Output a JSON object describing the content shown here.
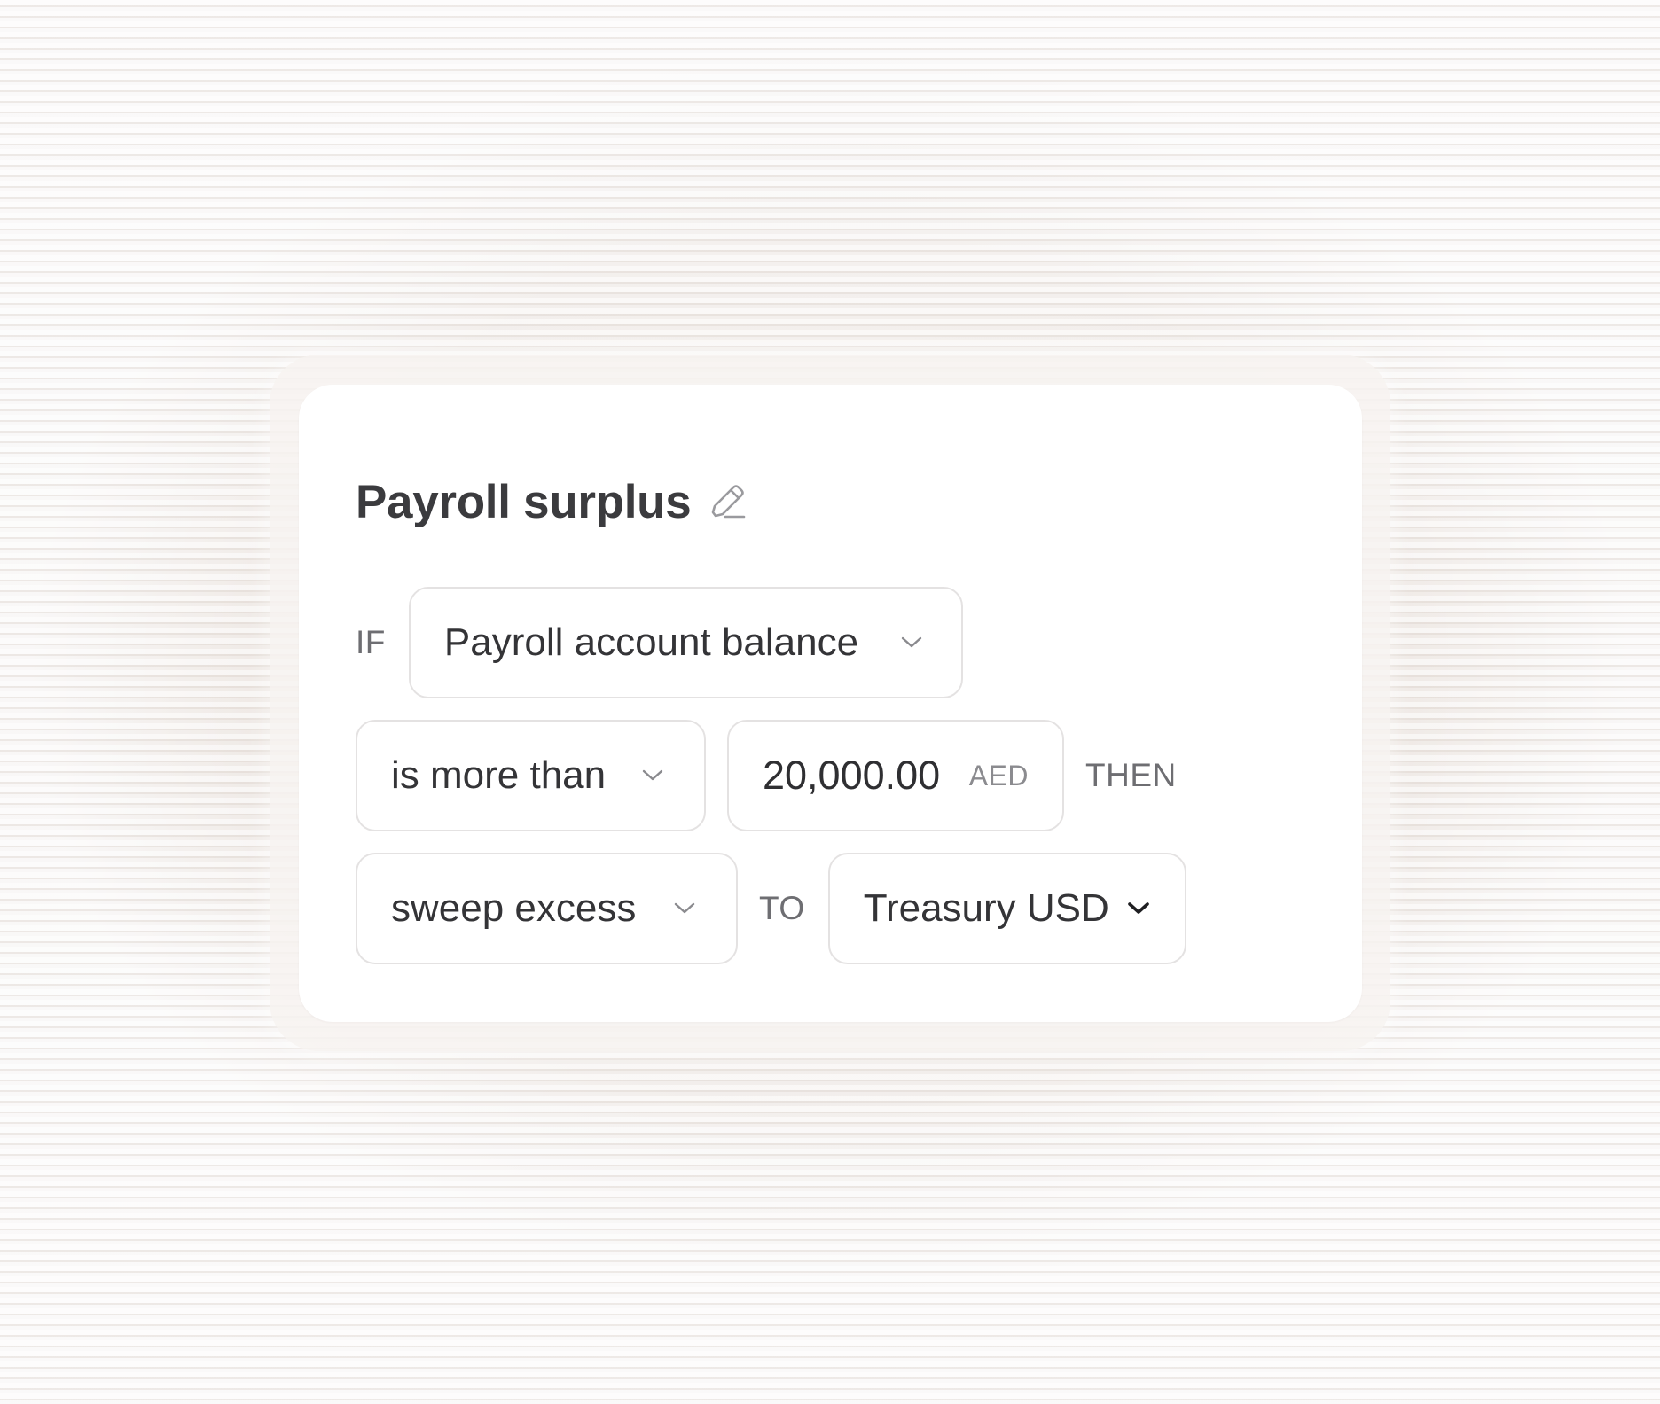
{
  "rule": {
    "title": "Payroll surplus",
    "edit_icon": "pencil-icon"
  },
  "condition": {
    "if_label": "IF",
    "metric": "Payroll account balance",
    "comparator": "is more than",
    "amount": "20,000.00",
    "currency": "AED",
    "then_label": "THEN"
  },
  "action": {
    "operation": "sweep excess",
    "to_label": "TO",
    "destination": "Treasury USD"
  },
  "colors": {
    "text_primary": "#3b3b3e",
    "text_keyword": "#6e6e72",
    "border": "#e4e2e2",
    "card_bg": "#ffffff"
  }
}
